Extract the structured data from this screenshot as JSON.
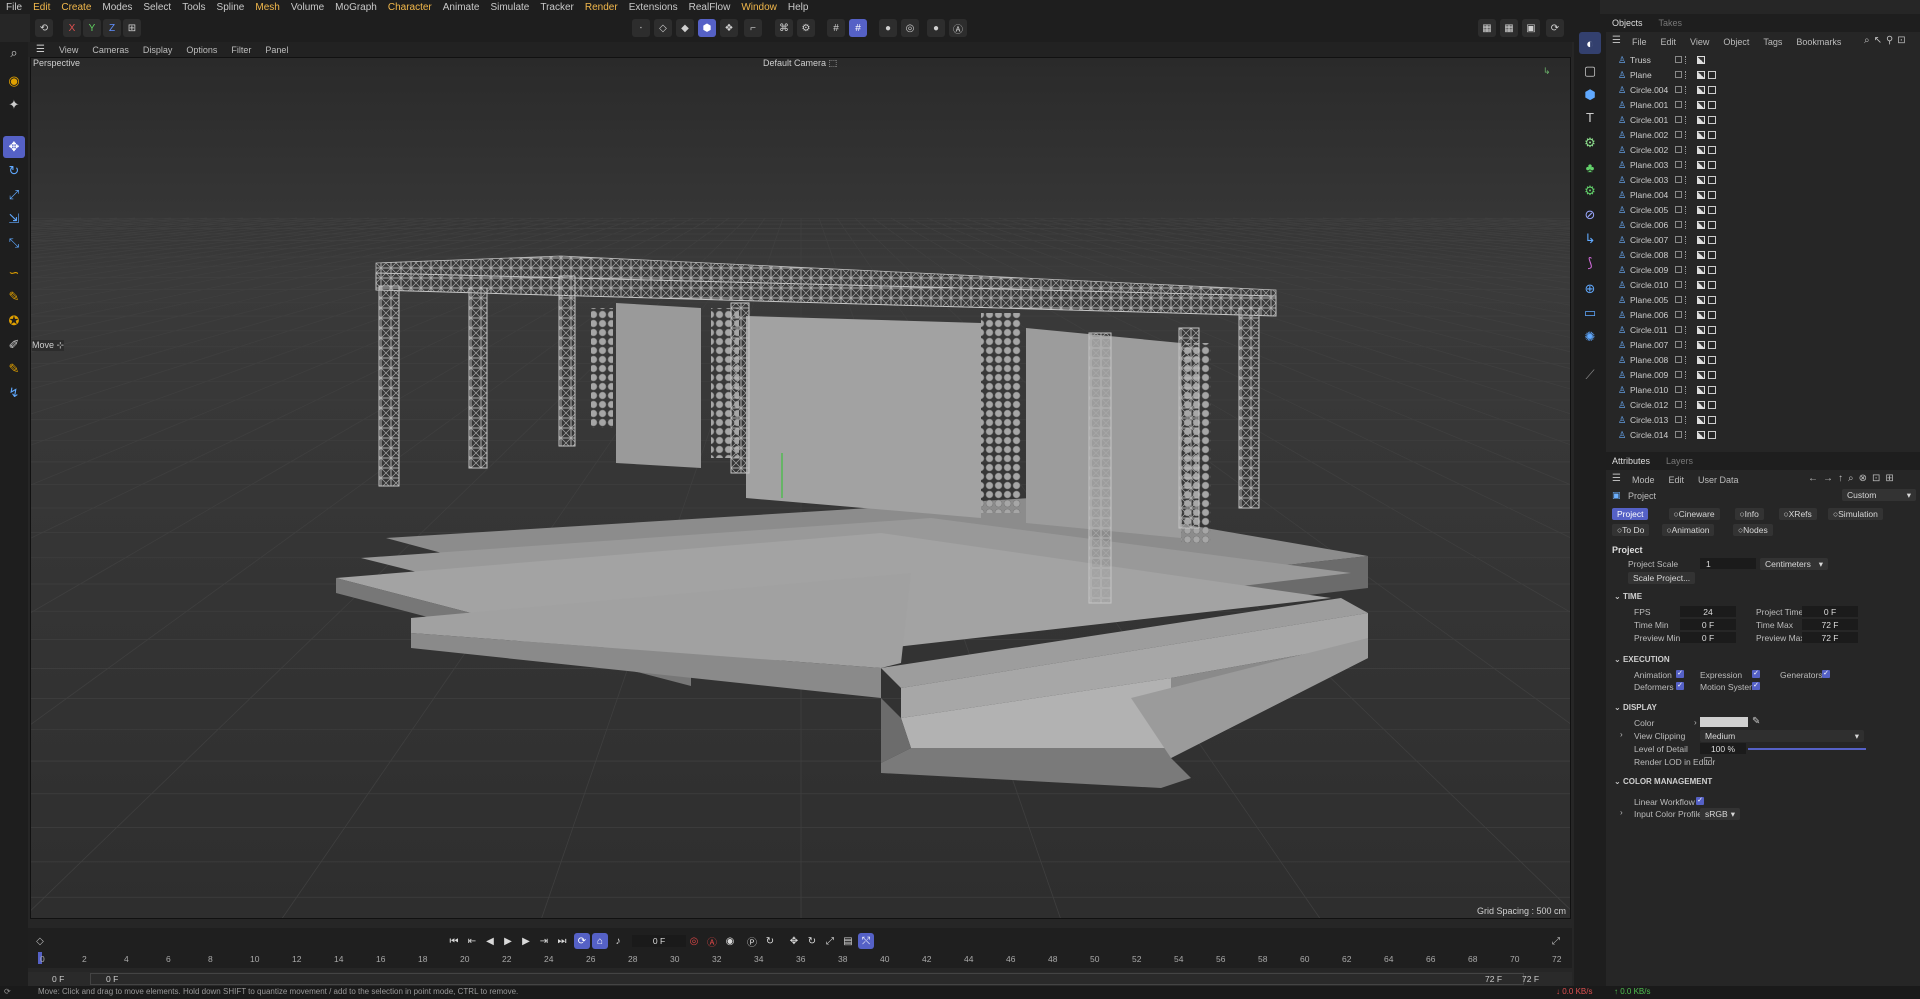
{
  "menu": [
    "File",
    "Edit",
    "Create",
    "Modes",
    "Select",
    "Tools",
    "Spline",
    "Mesh",
    "Volume",
    "MoGraph",
    "Character",
    "Animate",
    "Simulate",
    "Tracker",
    "Render",
    "Extensions",
    "RealFlow",
    "Window",
    "Help"
  ],
  "menu_accent": [
    "Edit",
    "Create",
    "Mesh",
    "Character",
    "Render",
    "Window"
  ],
  "axis_buttons": [
    "X",
    "Y",
    "Z"
  ],
  "viewport": {
    "menu": [
      "View",
      "Cameras",
      "Display",
      "Options",
      "Filter",
      "Panel"
    ],
    "projection": "Perspective",
    "camera": "Default Camera",
    "tool_label": "Move",
    "grid_spacing": "Grid Spacing : 500 cm"
  },
  "objects": {
    "tabs": [
      "Objects",
      "Takes"
    ],
    "menu": [
      "File",
      "Edit",
      "View",
      "Object",
      "Tags",
      "Bookmarks"
    ],
    "items": [
      "Truss",
      "Plane",
      "Circle.004",
      "Plane.001",
      "Circle.001",
      "Plane.002",
      "Circle.002",
      "Plane.003",
      "Circle.003",
      "Plane.004",
      "Circle.005",
      "Circle.006",
      "Circle.007",
      "Circle.008",
      "Circle.009",
      "Circle.010",
      "Plane.005",
      "Plane.006",
      "Circle.011",
      "Plane.007",
      "Plane.008",
      "Plane.009",
      "Plane.010",
      "Circle.012",
      "Circle.013",
      "Circle.014"
    ]
  },
  "attributes": {
    "tabs": [
      "Attributes",
      "Layers"
    ],
    "menu": [
      "Mode",
      "Edit",
      "User Data"
    ],
    "object_label": "Project",
    "mode_value": "Custom",
    "subtabs_row1": [
      "Project",
      "Cineware",
      "Info",
      "XRefs",
      "Simulation"
    ],
    "subtabs_row2": [
      "To Do",
      "Animation",
      "Nodes"
    ],
    "section_title": "Project",
    "project_scale_label": "Project Scale",
    "project_scale_value": "1",
    "project_scale_unit": "Centimeters",
    "scale_project_button": "Scale Project...",
    "time": {
      "header": "TIME",
      "fps_label": "FPS",
      "fps": "24",
      "project_time_label": "Project Time",
      "project_time": "0 F",
      "time_min_label": "Time Min",
      "time_min": "0 F",
      "time_max_label": "Time Max",
      "time_max": "72 F",
      "preview_min_label": "Preview Min",
      "preview_min": "0 F",
      "preview_max_label": "Preview Max",
      "preview_max": "72 F"
    },
    "execution": {
      "header": "EXECUTION",
      "animation": "Animation",
      "expression": "Expression",
      "generators": "Generators",
      "deformers": "Deformers",
      "motion_system": "Motion System"
    },
    "display": {
      "header": "DISPLAY",
      "color_label": "Color",
      "view_clipping_label": "View Clipping",
      "view_clipping": "Medium",
      "lod_label": "Level of Detail",
      "lod": "100 %",
      "lod_fraction": 1.0,
      "render_lod_label": "Render LOD in Editor"
    },
    "color_management": {
      "header": "COLOR MANAGEMENT",
      "linear_workflow": "Linear Workflow",
      "input_profile_label": "Input Color Profile",
      "input_profile": "sRGB"
    }
  },
  "timeline": {
    "current_frame": "0 F",
    "ticks": [
      "0",
      "2",
      "4",
      "6",
      "8",
      "10",
      "12",
      "14",
      "16",
      "18",
      "20",
      "22",
      "24",
      "26",
      "28",
      "30",
      "32",
      "34",
      "36",
      "38",
      "40",
      "42",
      "44",
      "46",
      "48",
      "50",
      "52",
      "54",
      "56",
      "58",
      "60",
      "62",
      "64",
      "66",
      "68",
      "70",
      "72"
    ],
    "range_start": "0 F",
    "range_start2": "0 F",
    "range_end": "72 F",
    "range_end2": "72 F"
  },
  "status": {
    "message": "Move: Click and drag to move elements. Hold down SHIFT to quantize movement / add to the selection in point mode, CTRL to remove.",
    "net_down": "0.0 KB/s",
    "net_up": "0.0 KB/s"
  },
  "colors": {
    "accent": "#5561c6",
    "menu_accent": "#f2b84b",
    "object_icon": "#6cb0ff"
  }
}
